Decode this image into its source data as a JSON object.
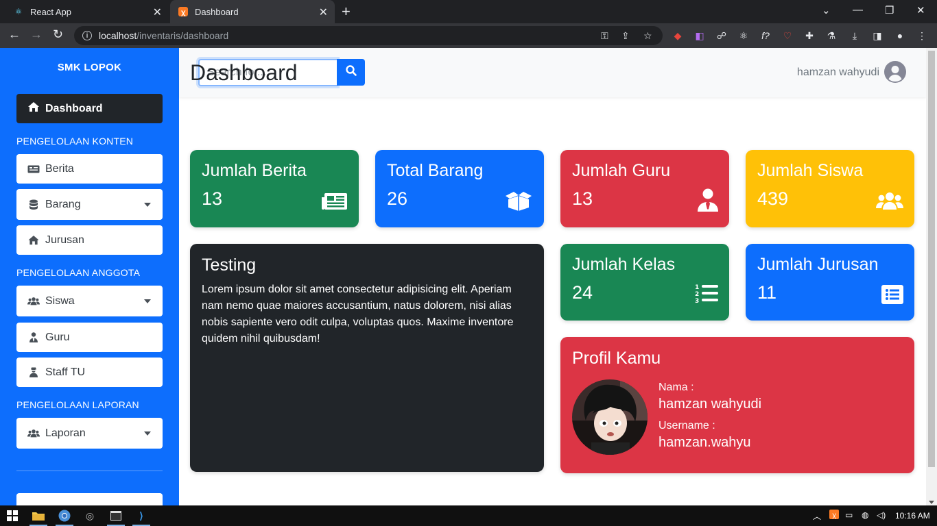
{
  "browser": {
    "tabs": [
      {
        "title": "React App",
        "active": false,
        "favicon": "react-icon"
      },
      {
        "title": "Dashboard",
        "active": true,
        "favicon": "xampp-icon"
      }
    ],
    "url_host": "localhost",
    "url_path": "/inventaris/dashboard"
  },
  "sidebar": {
    "brand": "SMK LOPOK",
    "active_item": "Dashboard",
    "sections": {
      "konten": "PENGELOLAAN KONTEN",
      "anggota": "PENGELOLAAN ANGGOTA",
      "laporan": "PENGELOLAAN LAPORAN"
    },
    "items": {
      "berita": "Berita",
      "barang": "Barang",
      "jurusan": "Jurusan",
      "siswa": "Siswa",
      "guru": "Guru",
      "staff": "Staff TU",
      "laporan": "Laporan"
    }
  },
  "topbar": {
    "search_placeholder": "Search for...",
    "user_name": "hamzan wahyudi"
  },
  "main": {
    "title": "Dashboard",
    "stats": {
      "berita": {
        "label": "Jumlah Berita",
        "value": "13"
      },
      "barang": {
        "label": "Total Barang",
        "value": "26"
      },
      "guru": {
        "label": "Jumlah Guru",
        "value": "13"
      },
      "siswa": {
        "label": "Jumlah Siswa",
        "value": "439"
      },
      "kelas": {
        "label": "Jumlah Kelas",
        "value": "24"
      },
      "jurusan": {
        "label": "Jumlah Jurusan",
        "value": "11"
      }
    },
    "testing": {
      "title": "Testing",
      "body": "Lorem ipsum dolor sit amet consectetur adipisicing elit. Aperiam nam nemo quae maiores accusantium, natus dolorem, nisi alias nobis sapiente vero odit culpa, voluptas quos. Maxime inventore quidem nihil quibusdam!"
    },
    "profile": {
      "title": "Profil Kamu",
      "name_label": "Nama :",
      "name": "hamzan wahyudi",
      "username_label": "Username :",
      "username": "hamzan.wahyu"
    }
  },
  "taskbar": {
    "time": "10:16 AM"
  },
  "colors": {
    "primary": "#0d6efd",
    "success": "#198754",
    "danger": "#dc3545",
    "warning": "#ffc107",
    "dark": "#212529"
  }
}
